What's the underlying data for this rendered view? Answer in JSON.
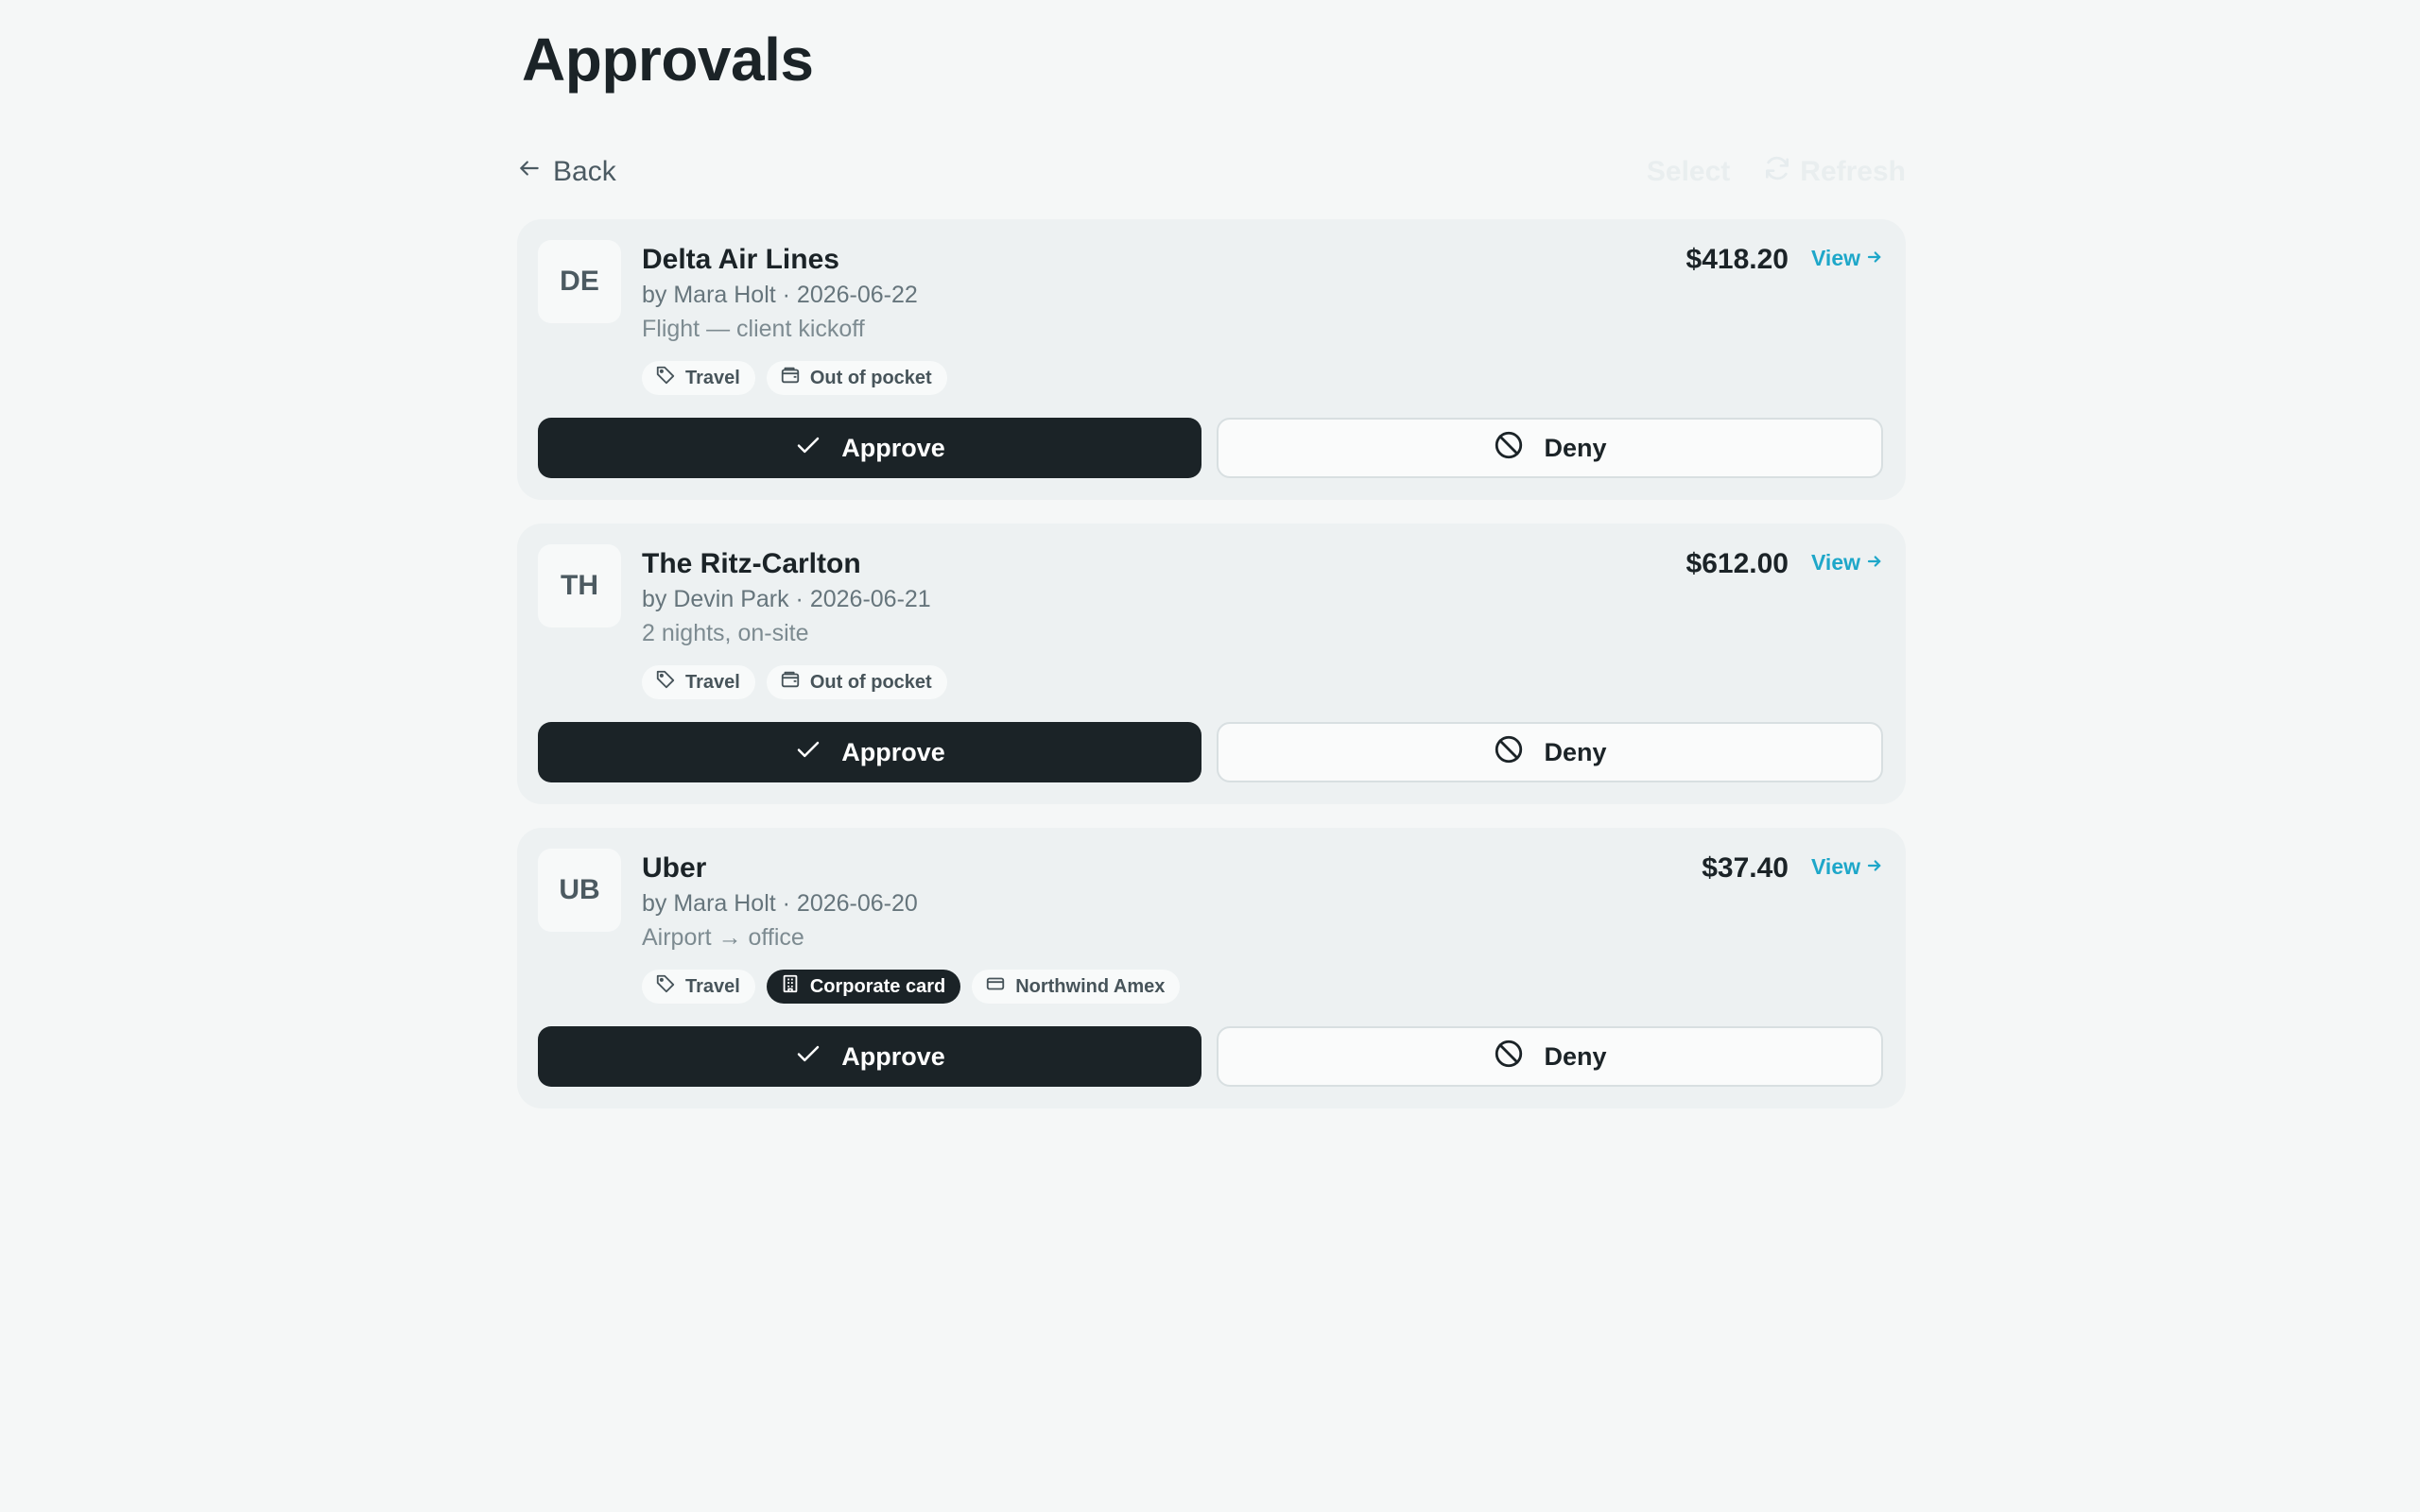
{
  "page": {
    "title": "Approvals"
  },
  "toolbar": {
    "back_label": "Back",
    "select_label": "Select",
    "refresh_label": "Refresh"
  },
  "colors": {
    "primary_dark": "#1b2327",
    "accent_link": "#1ea7c9",
    "card_bg": "#edf1f2",
    "page_bg": "#f5f7f7"
  },
  "requests": [
    {
      "initials": "DE",
      "merchant": "Delta Air Lines",
      "meta": "by Mara Holt · 2026-06-22",
      "note": "Flight — client kickoff",
      "amount": "$418.20",
      "view_label": "View",
      "tags": [
        {
          "label": "Travel",
          "icon": "tag-icon"
        },
        {
          "label": "Out of pocket",
          "icon": "wallet-icon"
        }
      ],
      "approve_label": "Approve",
      "deny_label": "Deny"
    },
    {
      "initials": "TH",
      "merchant": "The Ritz-Carlton",
      "meta": "by Devin Park · 2026-06-21",
      "note": "2 nights, on-site",
      "amount": "$612.00",
      "view_label": "View",
      "tags": [
        {
          "label": "Travel",
          "icon": "tag-icon"
        },
        {
          "label": "Out of pocket",
          "icon": "wallet-icon"
        }
      ],
      "approve_label": "Approve",
      "deny_label": "Deny"
    },
    {
      "initials": "UB",
      "merchant": "Uber",
      "meta": "by Mara Holt · 2026-06-20",
      "note": "Airport → office",
      "amount": "$37.40",
      "view_label": "View",
      "tags": [
        {
          "label": "Travel",
          "icon": "tag-icon"
        },
        {
          "label": "Corporate card",
          "icon": "building-icon"
        },
        {
          "label": "Northwind Amex",
          "icon": "credit-card-icon"
        }
      ],
      "approve_label": "Approve",
      "deny_label": "Deny"
    }
  ]
}
